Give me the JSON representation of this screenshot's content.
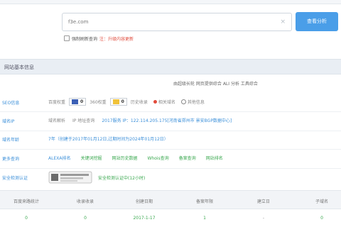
{
  "search": {
    "value": "f3e.com",
    "clear_symbol": "×",
    "button_label": "查看分析"
  },
  "force_update": {
    "label": "强制刷新查询",
    "note": "注：升级内容更新"
  },
  "section": {
    "title": "网站基本信息"
  },
  "tool_links": "由超级长轮 网页提供综合 ALI 分析 工具综合",
  "rows": {
    "seo": {
      "label": "SEO信息",
      "text1": "百度权重",
      "badge1": "0",
      "text2": "360权重",
      "badge2": "0",
      "text3": "历史收录",
      "text4": "相关域名",
      "text5": "其他信息"
    },
    "domain_ip": {
      "label": "域名IP",
      "text1": "域名解析",
      "text2": "IP 地址查询",
      "ip_info": "2017服务 IP：122.114.205.175[河南省郑州市 景安BGP数据中心]"
    },
    "whois": {
      "label": "域名年龄",
      "text": "7年（创建于2017年01月12日,过期时间为2024年01月12日）"
    },
    "more": {
      "label": "更多查询",
      "items": [
        "ALEXA排名",
        "关键词挖掘",
        "网站历史数据",
        "Whois查询",
        "备案查询",
        "网站排名"
      ]
    },
    "security": {
      "label": "安全检测认证",
      "text": "安全检测认证中(12小时)"
    }
  },
  "table": {
    "headers": [
      "百度来路统计",
      "收录收录",
      "创建日期",
      "备案年限",
      "建立日",
      "子域名"
    ],
    "values": [
      "0",
      "0",
      "2017-1-17",
      "1",
      "-",
      "0"
    ]
  },
  "colors": {
    "accent": "#4a9ee8",
    "link": "#3b8fd9",
    "green": "#3aa84f",
    "red": "#e24b3b"
  }
}
